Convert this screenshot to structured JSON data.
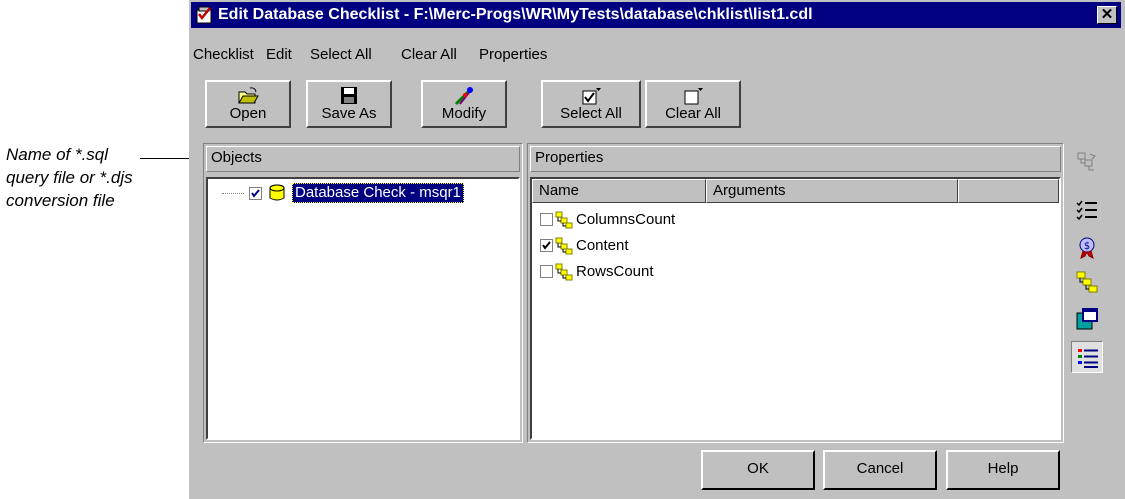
{
  "annotation": {
    "lines": [
      "Name of *.sql",
      "query file or *.djs",
      "conversion file"
    ]
  },
  "window": {
    "title": "Edit Database Checklist - F:\\Merc-Progs\\WR\\MyTests\\database\\chklist\\list1.cdl",
    "close_glyph": "✕"
  },
  "menu": [
    "Checklist",
    "Edit",
    "Select All",
    "Clear All",
    "Properties"
  ],
  "toolbar": {
    "open": "Open",
    "save_as": "Save As",
    "modify": "Modify",
    "select_all": "Select All",
    "clear_all": "Clear All"
  },
  "objects_panel": {
    "header": "Objects",
    "items": [
      {
        "label": "Database Check - msqr1",
        "checked": true,
        "icon": "database-icon"
      }
    ]
  },
  "properties_panel": {
    "header": "Properties",
    "columns": [
      "Name",
      "Arguments"
    ],
    "rows": [
      {
        "name": "ColumnsCount",
        "checked": false,
        "icon": "property-tree-icon"
      },
      {
        "name": "Content",
        "checked": true,
        "icon": "property-tree-icon"
      },
      {
        "name": "RowsCount",
        "checked": false,
        "icon": "property-tree-icon"
      }
    ]
  },
  "side_toolbar": [
    "disabled-tree-icon",
    "checklist-icon",
    "award-icon",
    "property-tree-icon",
    "window-icon",
    "list-view-icon"
  ],
  "buttons": {
    "ok": "OK",
    "cancel": "Cancel",
    "help": "Help"
  },
  "colors": {
    "titlebar": "#000080",
    "face": "#c0c0c0",
    "selection": "#000080",
    "accent_yellow": "#ffff00"
  }
}
